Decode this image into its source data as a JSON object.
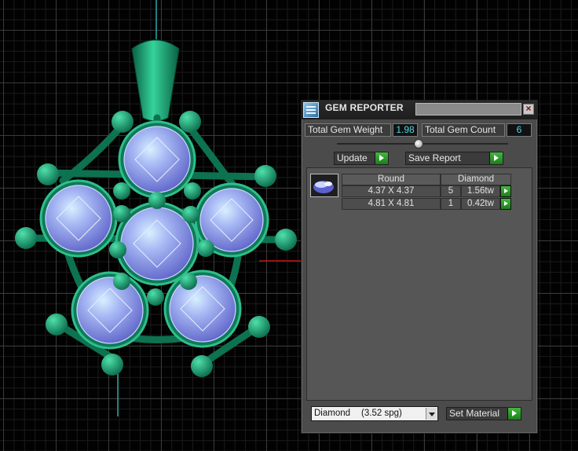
{
  "colors": {
    "metal": "#0f7a58",
    "metal_light": "#2fbf8c",
    "gem": "#7f8fe6",
    "gem_highlight": "#d7f0ff",
    "viewport_bg": "#020202",
    "axis_red": "#c01818",
    "axis_cyan": "#2aa9a6",
    "accent_green": "#2aa52a",
    "value_cyan": "#4fd6e8"
  },
  "icons": {
    "app": "gem-reporter-app-icon",
    "close": "close-icon",
    "go": "green-play-arrow-icon",
    "dropdown": "chevron-down-icon",
    "gem_thumb": "round-gem-icon"
  },
  "window": {
    "title": "GEM REPORTER",
    "close_label": "×"
  },
  "stats": {
    "weight_label": "Total Gem Weight",
    "weight_value": "1.98",
    "count_label": "Total Gem Count",
    "count_value": "6"
  },
  "toolbar": {
    "update_label": "Update",
    "save_label": "Save Report"
  },
  "report": {
    "headers": [
      "Round",
      "Diamond"
    ],
    "rows": [
      {
        "size": "4.37 X 4.37",
        "qty": "5",
        "tw": "1.56tw"
      },
      {
        "size": "4.81 X 4.81",
        "qty": "1",
        "tw": "0.42tw"
      }
    ]
  },
  "material": {
    "name": "Diamond",
    "density": "(3.52 spg)",
    "set_label": "Set Material"
  }
}
